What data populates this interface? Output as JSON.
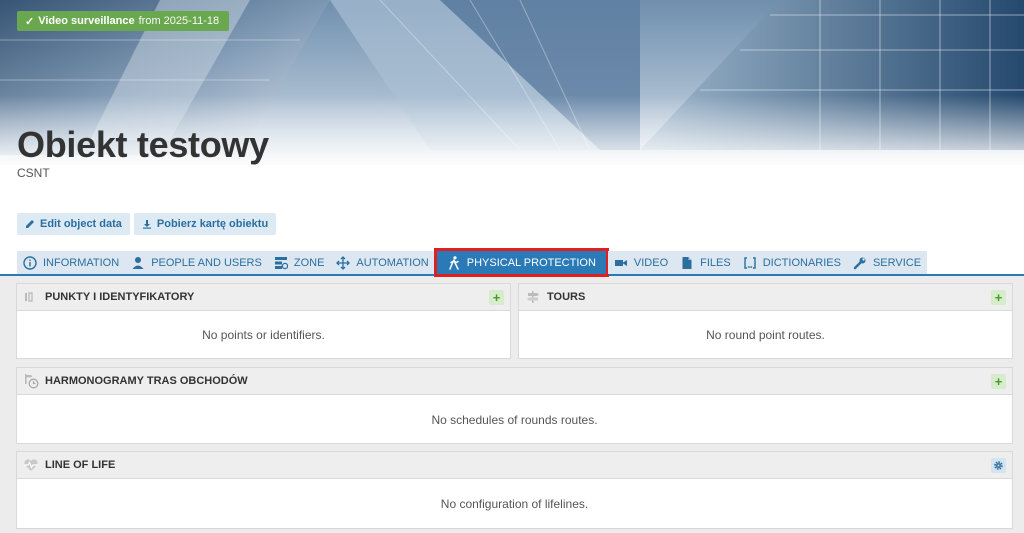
{
  "header": {
    "badge_label": "Video surveillance",
    "badge_from": "from 2025-11-18",
    "title": "Obiekt testowy",
    "subtitle": "CSNT",
    "actions": {
      "edit_label": "Edit object data",
      "download_label": "Pobierz kartę obiektu"
    }
  },
  "tabs": [
    {
      "label": "Information",
      "icon": "info-icon"
    },
    {
      "label": "People and users",
      "icon": "person-icon"
    },
    {
      "label": "Zone",
      "icon": "zone-icon"
    },
    {
      "label": "Automation",
      "icon": "automation-icon"
    },
    {
      "label": "Physical protection",
      "icon": "walking-person-icon",
      "active": true
    },
    {
      "label": "Video",
      "icon": "video-camera-icon"
    },
    {
      "label": "Files",
      "icon": "file-icon"
    },
    {
      "label": "Dictionaries",
      "icon": "brackets-icon"
    },
    {
      "label": "Service",
      "icon": "wrench-icon"
    }
  ],
  "panels": {
    "points": {
      "title": "Punkty i identyfikatory",
      "empty": "No points or identifiers."
    },
    "tours": {
      "title": "Tours",
      "empty": "No round point routes."
    },
    "schedules": {
      "title": "Harmonogramy tras obchodów",
      "empty": "No schedules of rounds routes."
    },
    "lifeline": {
      "title": "Line of life",
      "empty": "No configuration of lifelines."
    }
  },
  "colors": {
    "accent": "#2b7ab8",
    "badge_green": "#6aa84f",
    "active_tab_outline": "#e02020"
  }
}
